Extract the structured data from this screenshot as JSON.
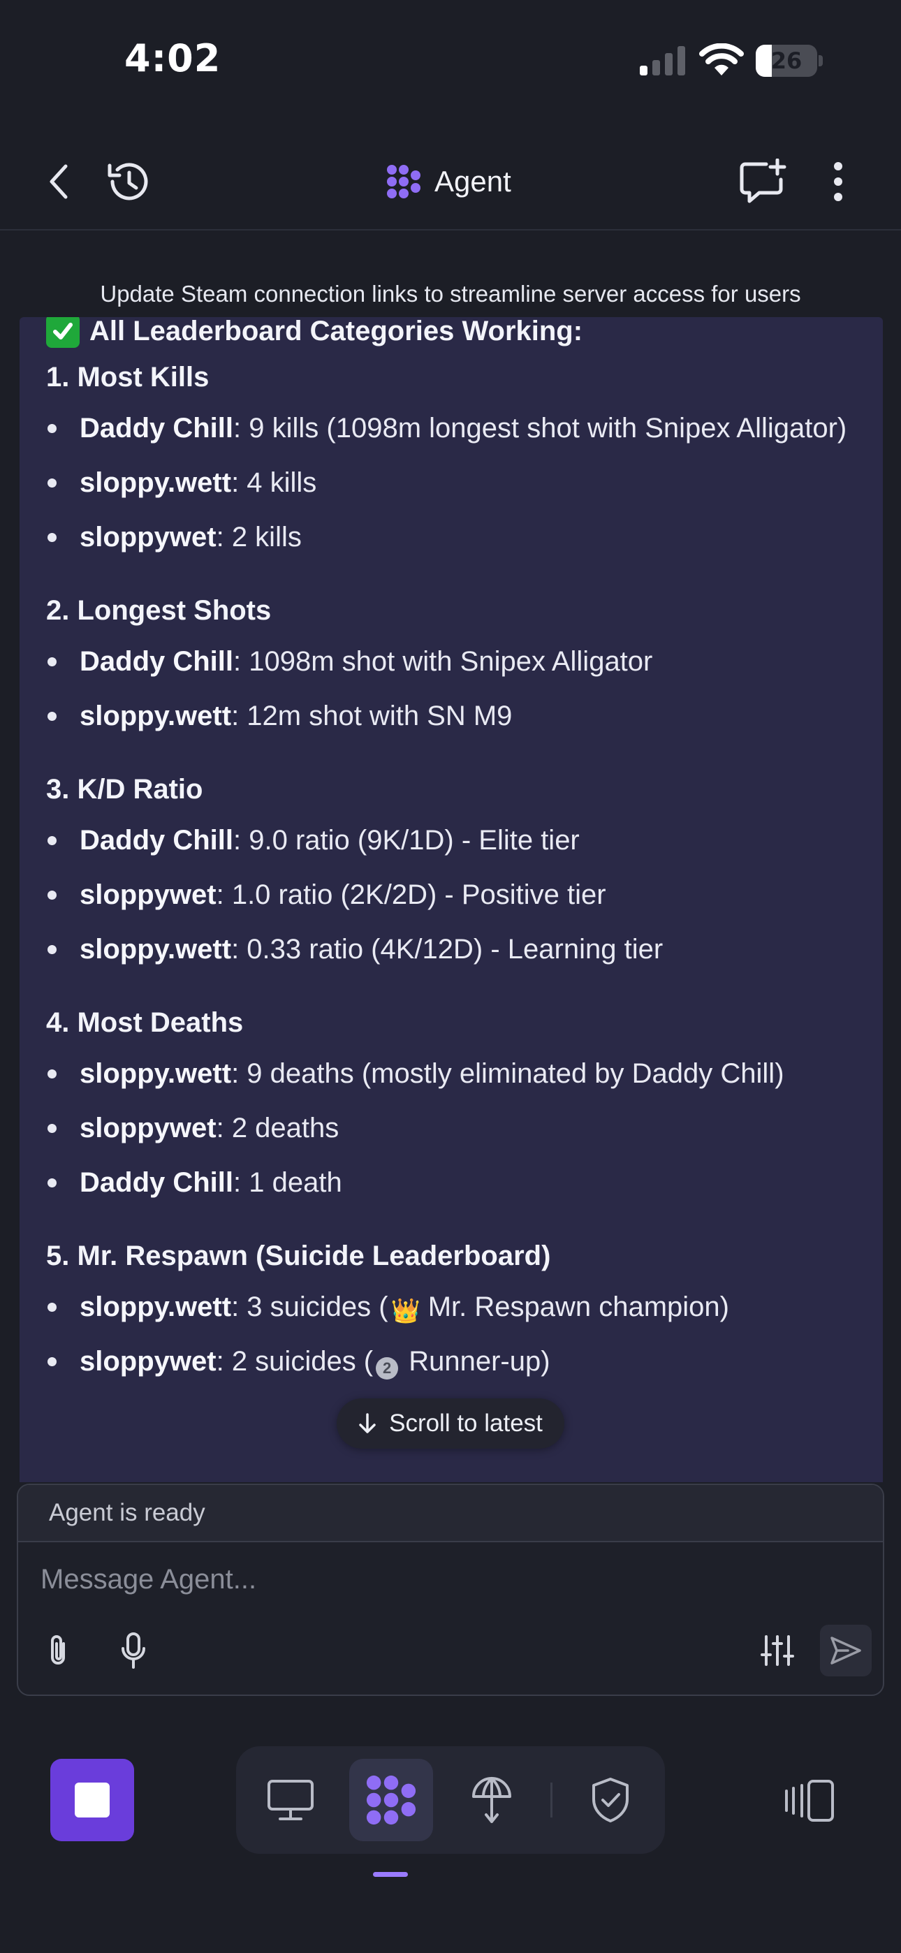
{
  "status_bar": {
    "time": "4:02",
    "battery_level": "26",
    "battery_fraction": 0.26
  },
  "header": {
    "title": "Agent",
    "icons": [
      "back-icon",
      "history-icon",
      "agent-logo-icon",
      "new-chat-icon",
      "more-vertical-icon"
    ]
  },
  "chat": {
    "context_line": "Update Steam connection links to streamline server access for users",
    "heading": "All Leaderboard Categories Working:",
    "sections": [
      {
        "title": "1. Most Kills",
        "items": [
          {
            "name": "Daddy Chill",
            "text": ": 9 kills (1098m longest shot with Snipex Alligator)"
          },
          {
            "name": "sloppy.wett",
            "text": ": 4 kills"
          },
          {
            "name": "sloppywet",
            "text": ": 2 kills"
          }
        ]
      },
      {
        "title": "2. Longest Shots",
        "items": [
          {
            "name": "Daddy Chill",
            "text": ": 1098m shot with Snipex Alligator"
          },
          {
            "name": "sloppy.wett",
            "text": ": 12m shot with SN M9"
          }
        ]
      },
      {
        "title": "3. K/D Ratio",
        "items": [
          {
            "name": "Daddy Chill",
            "text": ": 9.0 ratio (9K/1D) - Elite tier"
          },
          {
            "name": "sloppywet",
            "text": ": 1.0 ratio (2K/2D) - Positive tier"
          },
          {
            "name": "sloppy.wett",
            "text": ": 0.33 ratio (4K/12D) - Learning tier"
          }
        ]
      },
      {
        "title": "4. Most Deaths",
        "items": [
          {
            "name": "sloppy.wett",
            "text": ": 9 deaths (mostly eliminated by Daddy Chill)"
          },
          {
            "name": "sloppywet",
            "text": ": 2 deaths"
          },
          {
            "name": "Daddy Chill",
            "text": ": 1 death"
          }
        ]
      },
      {
        "title": "5. Mr. Respawn (Suicide Leaderboard)",
        "items": [
          {
            "name": "sloppy.wett",
            "text_before": ": 3 suicides (",
            "badge": "👑",
            "text_after": " Mr. Respawn champion)"
          },
          {
            "name": "sloppywet",
            "text_before": ": 2 suicides (",
            "badge": "2",
            "text_after": " Runner-up)"
          }
        ]
      }
    ],
    "scroll_to_latest": "Scroll to latest"
  },
  "composer": {
    "status": "Agent is ready",
    "placeholder": "Message Agent..."
  },
  "colors": {
    "background": "#1c1e26",
    "message_card": "#2a2947",
    "accent": "#8f6df5",
    "stop_button": "#6a3ddb",
    "check": "#1fa83a"
  }
}
